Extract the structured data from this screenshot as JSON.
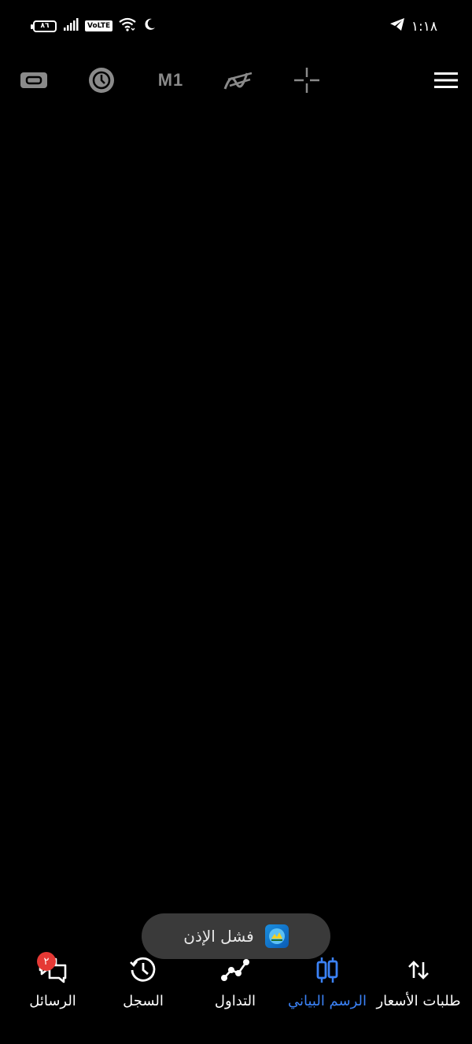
{
  "status_bar": {
    "battery_level": "٨٦",
    "network_badge": "VoLTE",
    "time": "١:١٨",
    "icons": [
      "battery-icon",
      "signal-icon",
      "volte-icon",
      "wifi-icon",
      "moon-icon",
      "telegram-icon"
    ]
  },
  "toolbar": {
    "timeframe": "M1",
    "icons": [
      "symbol-link-icon",
      "clock-icon",
      "indicator-icon",
      "crosshair-icon",
      "menu-icon"
    ]
  },
  "toast": {
    "message": "فشل الإذن",
    "icon": "metatrader-app-icon"
  },
  "bottom_nav": {
    "active_color": "#3b82f6",
    "items": [
      {
        "label": "طلبات الأسعار",
        "icon": "quotes-arrows-icon",
        "active": false
      },
      {
        "label": "الرسم البياني",
        "icon": "candlestick-chart-icon",
        "active": true
      },
      {
        "label": "التداول",
        "icon": "trade-line-icon",
        "active": false
      },
      {
        "label": "السجل",
        "icon": "history-icon",
        "active": false
      },
      {
        "label": "الرسائل",
        "icon": "messages-icon",
        "active": false,
        "badge": "٢"
      }
    ]
  }
}
